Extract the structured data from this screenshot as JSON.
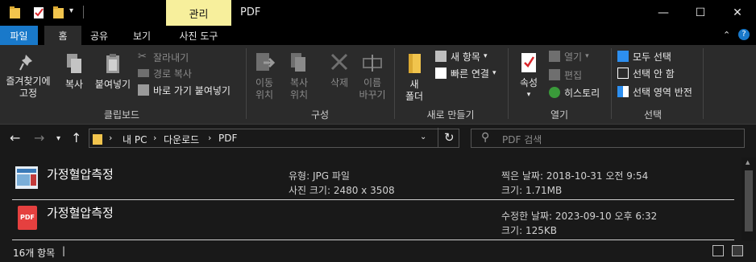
{
  "window": {
    "context_tab": "관리",
    "title": "PDF",
    "minimize": "—",
    "maximize": "☐",
    "close": "✕"
  },
  "tabs": {
    "file": "파일",
    "home": "홈",
    "share": "공유",
    "view": "보기",
    "tools": "사진 도구"
  },
  "ribbon": {
    "clipboard": {
      "pin": "즐겨찾기에\n고정",
      "copy": "복사",
      "paste": "붙여넣기",
      "cut": "잘라내기",
      "copy_path": "경로 복사",
      "paste_shortcut": "바로 가기 붙여넣기",
      "label": "클립보드"
    },
    "organize": {
      "move_to": "이동\n위치",
      "copy_to": "복사\n위치",
      "delete": "삭제",
      "rename": "이름\n바꾸기",
      "label": "구성"
    },
    "new": {
      "new_folder": "새\n폴더",
      "new_item": "새 항목",
      "easy_access": "빠른 연결",
      "label": "새로 만들기"
    },
    "open": {
      "properties": "속성",
      "open": "열기",
      "edit": "편집",
      "history": "히스토리",
      "label": "열기"
    },
    "select": {
      "select_all": "모두 선택",
      "select_none": "선택 안 함",
      "invert": "선택 영역 반전",
      "label": "선택"
    }
  },
  "address": {
    "crumbs": [
      "내 PC",
      "다운로드",
      "PDF"
    ],
    "search_placeholder": "PDF 검색"
  },
  "items": [
    {
      "name": "가정혈압측정",
      "type": "유형: JPG 파일",
      "dimensions": "사진 크기: 2480 x 3508",
      "date": "찍은 날짜: 2018-10-31 오전 9:54",
      "size": "크기: 1.71MB"
    },
    {
      "name": "가정혈압측정",
      "date": "수정한 날짜: 2023-09-10 오후 6:32",
      "size": "크기: 125KB",
      "pdf_label": "PDF"
    }
  ],
  "status": {
    "count": "16개 항목",
    "cursor": "|"
  },
  "colors": {
    "context_tab": "#f7ef9c",
    "file_tab": "#1979ca",
    "folder": "#f1c44d",
    "pdf": "#e5403f"
  }
}
